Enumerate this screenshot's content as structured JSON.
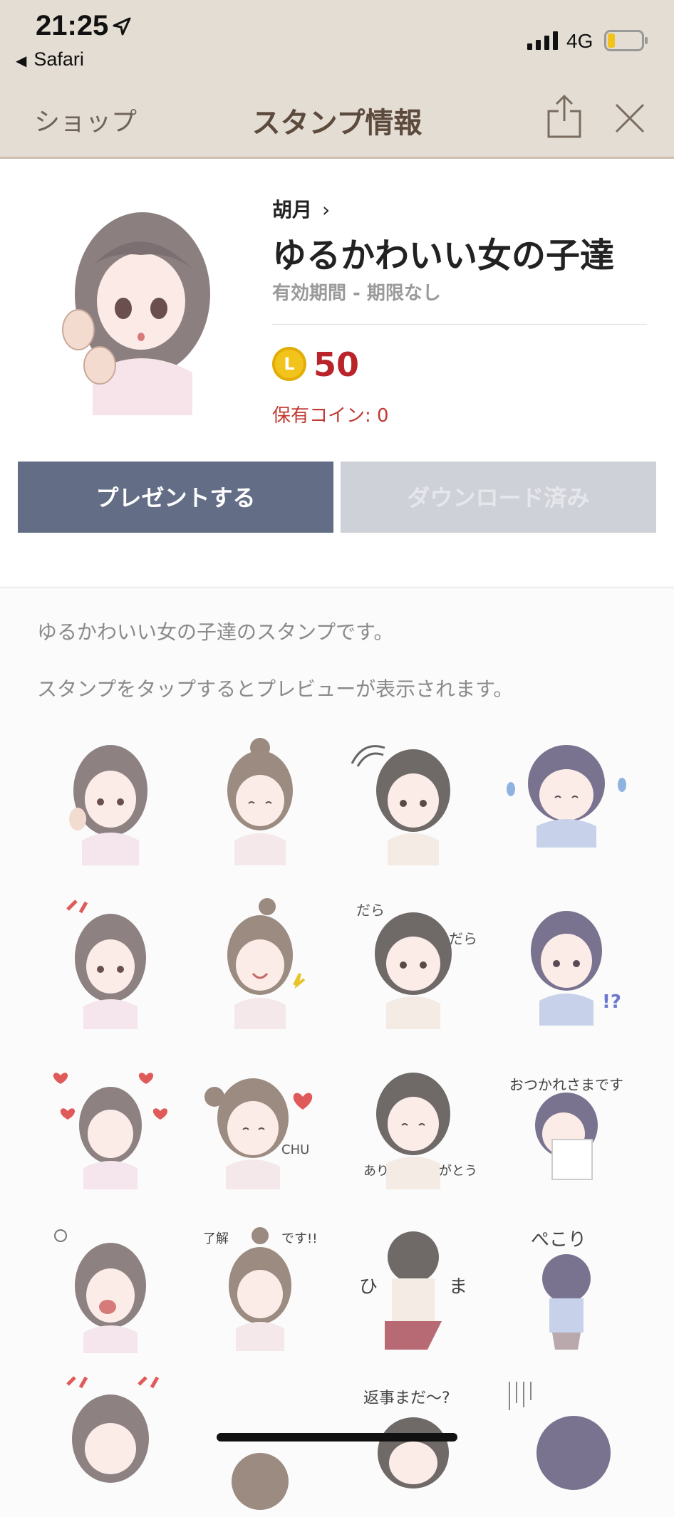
{
  "status_bar": {
    "time": "21:25",
    "back_app": "Safari",
    "network": "4G",
    "icons": [
      "location-arrow-icon",
      "signal-icon",
      "battery-icon"
    ],
    "battery_level": 0.2
  },
  "nav": {
    "left_label": "ショップ",
    "title": "スタンプ情報",
    "icons": [
      "share-icon",
      "close-icon"
    ]
  },
  "sticker_pack": {
    "author": "胡月",
    "title": "ゆるかわいい女の子達",
    "validity": "有効期間 - 期限なし",
    "coin_symbol": "L",
    "price": "50",
    "owned_coins": "保有コイン: 0",
    "present_button": "プレゼントする",
    "download_button": "ダウンロード済み"
  },
  "content": {
    "description": "ゆるかわいい女の子達のスタンプです。",
    "hint": "スタンプをタップするとプレビューが表示されます。"
  },
  "colors": {
    "nav_bg": "#e4ddd4",
    "accent_price": "#b9232a",
    "present_button": "#636d85",
    "download_button_disabled": "#cfd1d8"
  }
}
